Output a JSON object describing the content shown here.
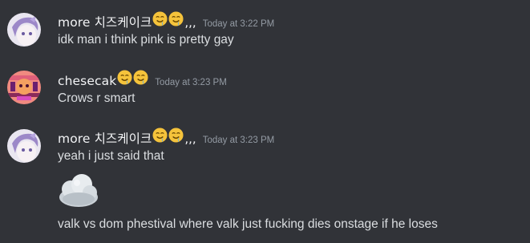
{
  "messages": [
    {
      "username": "more 치즈케이크",
      "username_suffix": ",,,",
      "timestamp": "Today at 3:22 PM",
      "lines": [
        "idk man i think pink is pretty gay"
      ]
    },
    {
      "username": "chesecak",
      "timestamp": "Today at 3:23 PM",
      "lines": [
        "Crows r smart"
      ]
    },
    {
      "username": "more 치즈케이크",
      "username_suffix": ",,,",
      "timestamp": "Today at 3:23 PM",
      "lines": [
        "yeah i just said that",
        "valk vs dom phestival where valk just fucking dies onstage if he loses"
      ]
    }
  ],
  "colors": {
    "background": "#313338",
    "username": "#f2f3f5",
    "text": "#dbdee1",
    "timestamp": "#949ba4"
  }
}
